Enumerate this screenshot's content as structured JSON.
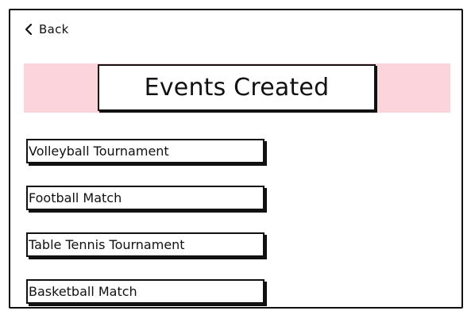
{
  "header": {
    "back_label": "Back"
  },
  "banner": {
    "title": "Events Created",
    "color": "#fcd4dc"
  },
  "events": [
    {
      "label": "Volleyball Tournament"
    },
    {
      "label": "Football Match"
    },
    {
      "label": "Table Tennis Tournament"
    },
    {
      "label": "Basketball Match"
    }
  ]
}
